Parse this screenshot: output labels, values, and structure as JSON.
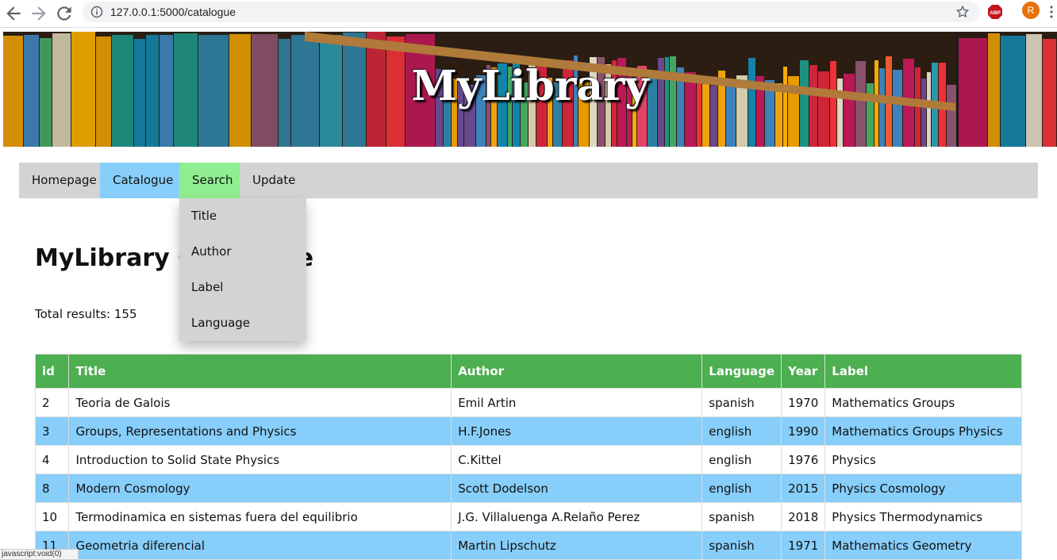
{
  "browser": {
    "url": "127.0.0.1:5000/catalogue",
    "profile_initial": "R",
    "extension_label": "ABP",
    "status_text": "javascript:void(0)"
  },
  "banner": {
    "title": "MyLibrary"
  },
  "nav": {
    "items": [
      "Homepage",
      "Catalogue",
      "Search",
      "Update"
    ],
    "active": "Catalogue",
    "hovered": "Search",
    "search_dropdown": [
      "Title",
      "Author",
      "Label",
      "Language"
    ]
  },
  "main": {
    "title": "MyLibrary Catalogue",
    "total_label": "Total results: 155"
  },
  "table": {
    "headers": [
      "id",
      "Title",
      "Author",
      "Language",
      "Year",
      "Label"
    ],
    "rows": [
      [
        "2",
        "Teoria de Galois",
        "Emil Artin",
        "spanish",
        "1970",
        "Mathematics Groups"
      ],
      [
        "3",
        "Groups, Representations and Physics",
        "H.F.Jones",
        "english",
        "1990",
        "Mathematics Groups Physics"
      ],
      [
        "4",
        "Introduction to Solid State Physics",
        "C.Kittel",
        "english",
        "1976",
        "Physics"
      ],
      [
        "8",
        "Modern Cosmology",
        "Scott Dodelson",
        "english",
        "2015",
        "Physics Cosmology"
      ],
      [
        "10",
        "Termodinamica en sistemas fuera del equilibrio",
        "J.G. Villaluenga A.Relaño Perez",
        "spanish",
        "2018",
        "Physics Thermodynamics"
      ],
      [
        "11",
        "Geometria diferencial",
        "Martin Lipschutz",
        "spanish",
        "1971",
        "Mathematics Geometry"
      ]
    ]
  },
  "colors": {
    "nav_bg": "#d3d3d3",
    "nav_active": "#87cefa",
    "nav_hover": "#90ee90",
    "table_header": "#4caf50",
    "row_alt": "#87cefa"
  },
  "icons": [
    "back-arrow-icon",
    "forward-arrow-icon",
    "reload-icon",
    "info-icon",
    "star-icon",
    "menu-dots-icon"
  ]
}
